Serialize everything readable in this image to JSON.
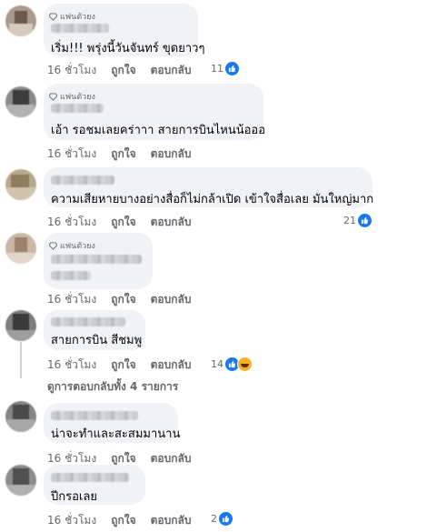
{
  "labels": {
    "fan_badge": "แฟนตัวยง",
    "like": "ถูกใจ",
    "reply": "ตอบกลับ"
  },
  "comments": [
    {
      "badge": true,
      "text": "เริ่ม!!! พรุ่งนี้วันจันทร์ ขุดยาวๆ",
      "time": "16 ชั่วโมง",
      "reactions": "11",
      "reaction_types": [
        "like"
      ]
    },
    {
      "badge": true,
      "text": "เอ้า รอชมเลยคร่าาา สายการบินไหนน้อออ",
      "time": "16 ชั่วโมง",
      "reactions": "",
      "reaction_types": []
    },
    {
      "badge": false,
      "text": "ความเสียหายบางอย่างสื่อก็ไม่กล้าเปิด เข้าใจสื่อเลย มันใหญ่มาก",
      "time": "16 ชั่วโมง",
      "reactions": "21",
      "reaction_types": [
        "like"
      ]
    },
    {
      "badge": true,
      "text": "",
      "time": "16 ชั่วโมง",
      "reactions": "",
      "reaction_types": []
    },
    {
      "badge": false,
      "text": "สายการบิน สีชมพู",
      "time": "16 ชั่วโมง",
      "reactions": "14",
      "reaction_types": [
        "like",
        "haha"
      ]
    },
    {
      "badge": false,
      "text": "น่าจะทำและสะสมมานาน",
      "time": "16 ชั่วโมง",
      "reactions": "",
      "reaction_types": []
    },
    {
      "badge": false,
      "text": "ปีกรอเลย",
      "time": "16 ชั่วโมง",
      "reactions": "2",
      "reaction_types": [
        "like"
      ]
    }
  ],
  "view_replies": "ดูการตอบกลับทั้ง 4 รายการ",
  "colors": {
    "bubble": "#f0f2f5",
    "meta": "#65676b",
    "like_blue": "#1877f2",
    "haha_yellow": "#f7b125"
  }
}
